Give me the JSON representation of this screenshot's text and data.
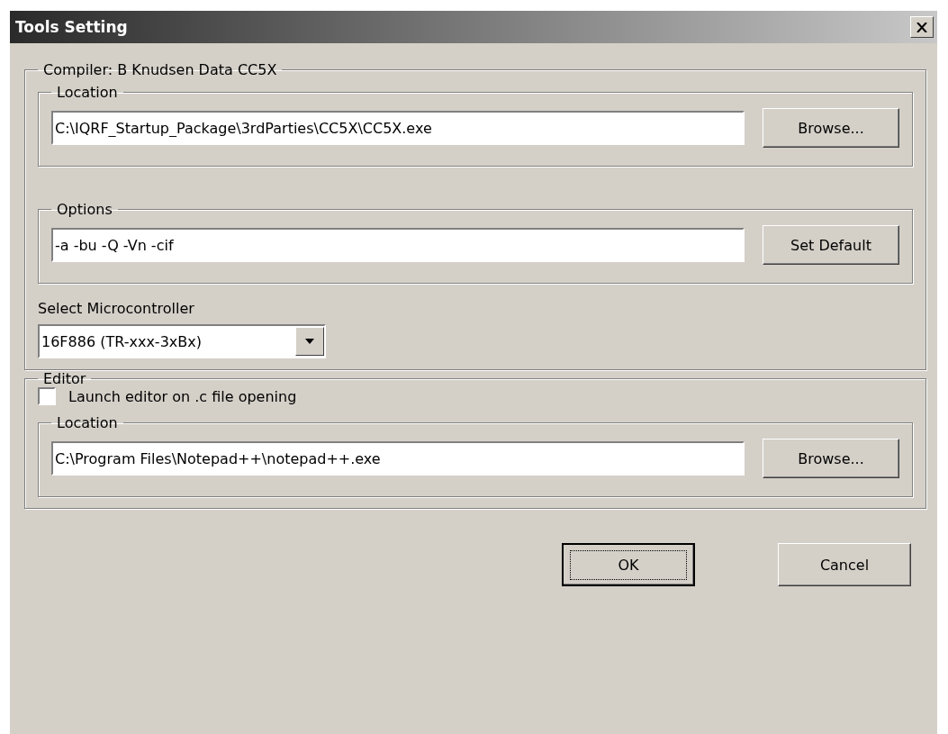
{
  "window": {
    "title": "Tools Setting"
  },
  "compiler": {
    "legend": "Compiler: B Knudsen Data CC5X",
    "location": {
      "legend": "Location",
      "value": "C:\\IQRF_Startup_Package\\3rdParties\\CC5X\\CC5X.exe",
      "button": "Browse..."
    },
    "options": {
      "legend": "Options",
      "value": "-a -bu -Q -Vn -cif",
      "button": "Set Default"
    },
    "microcontroller": {
      "label": "Select Microcontroller",
      "value": "16F886  (TR-xxx-3xBx)"
    }
  },
  "editor": {
    "legend": "Editor",
    "launch": {
      "label": "Launch editor on .c file opening",
      "checked": false
    },
    "location": {
      "legend": "Location",
      "value": "C:\\Program Files\\Notepad++\\notepad++.exe",
      "button": "Browse..."
    }
  },
  "buttons": [
    {
      "label": "OK",
      "focused": true
    },
    {
      "label": "Cancel",
      "focused": false
    }
  ]
}
